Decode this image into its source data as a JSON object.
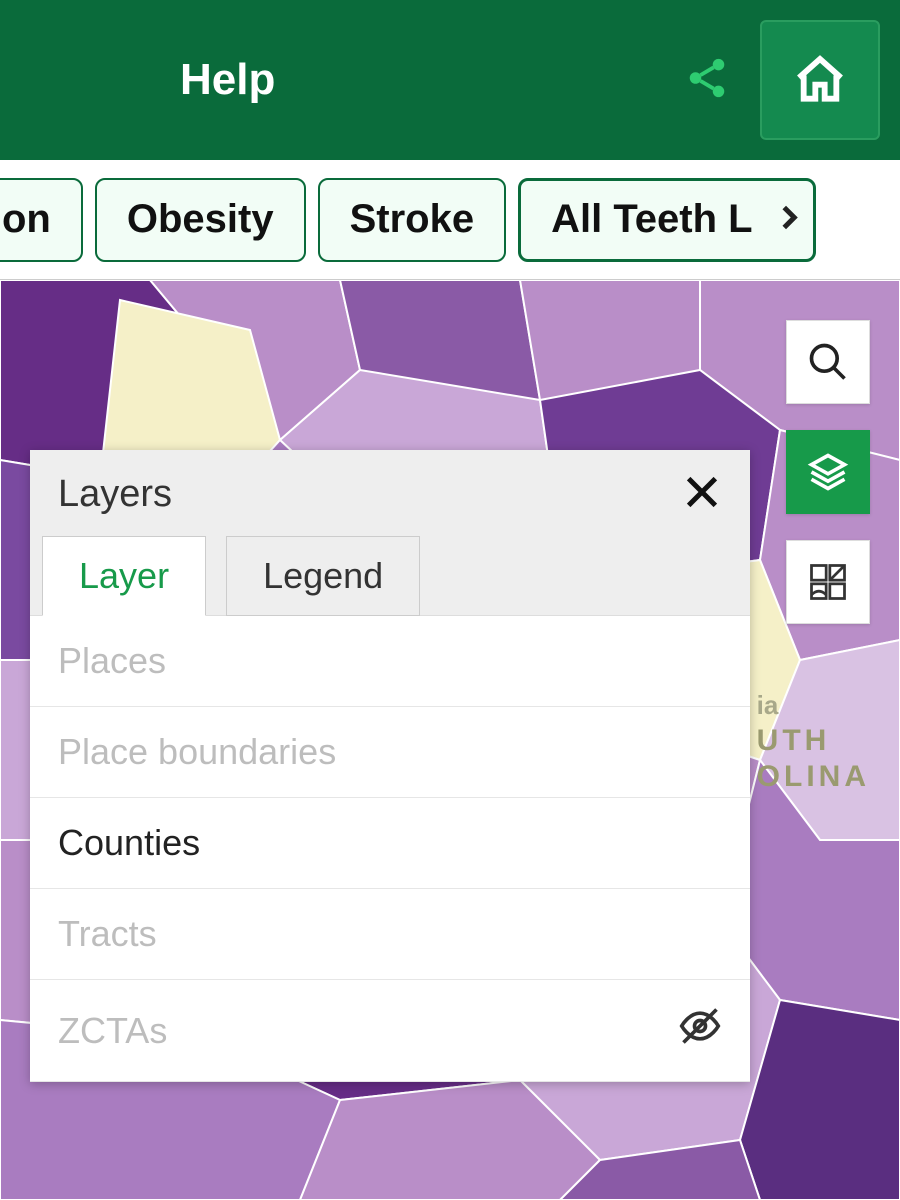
{
  "header": {
    "title": "Help"
  },
  "chips": {
    "partial_left": "on",
    "items": [
      "Obesity",
      "Stroke",
      "All Teeth L"
    ]
  },
  "map": {
    "label_small": "ia",
    "label_line1": "UTH",
    "label_line2": "OLINA"
  },
  "panel": {
    "title": "Layers",
    "tabs": {
      "layer": "Layer",
      "legend": "Legend"
    },
    "layers": {
      "places": "Places",
      "place_boundaries": "Place boundaries",
      "counties": "Counties",
      "tracts": "Tracts",
      "zctas": "ZCTAs"
    }
  }
}
